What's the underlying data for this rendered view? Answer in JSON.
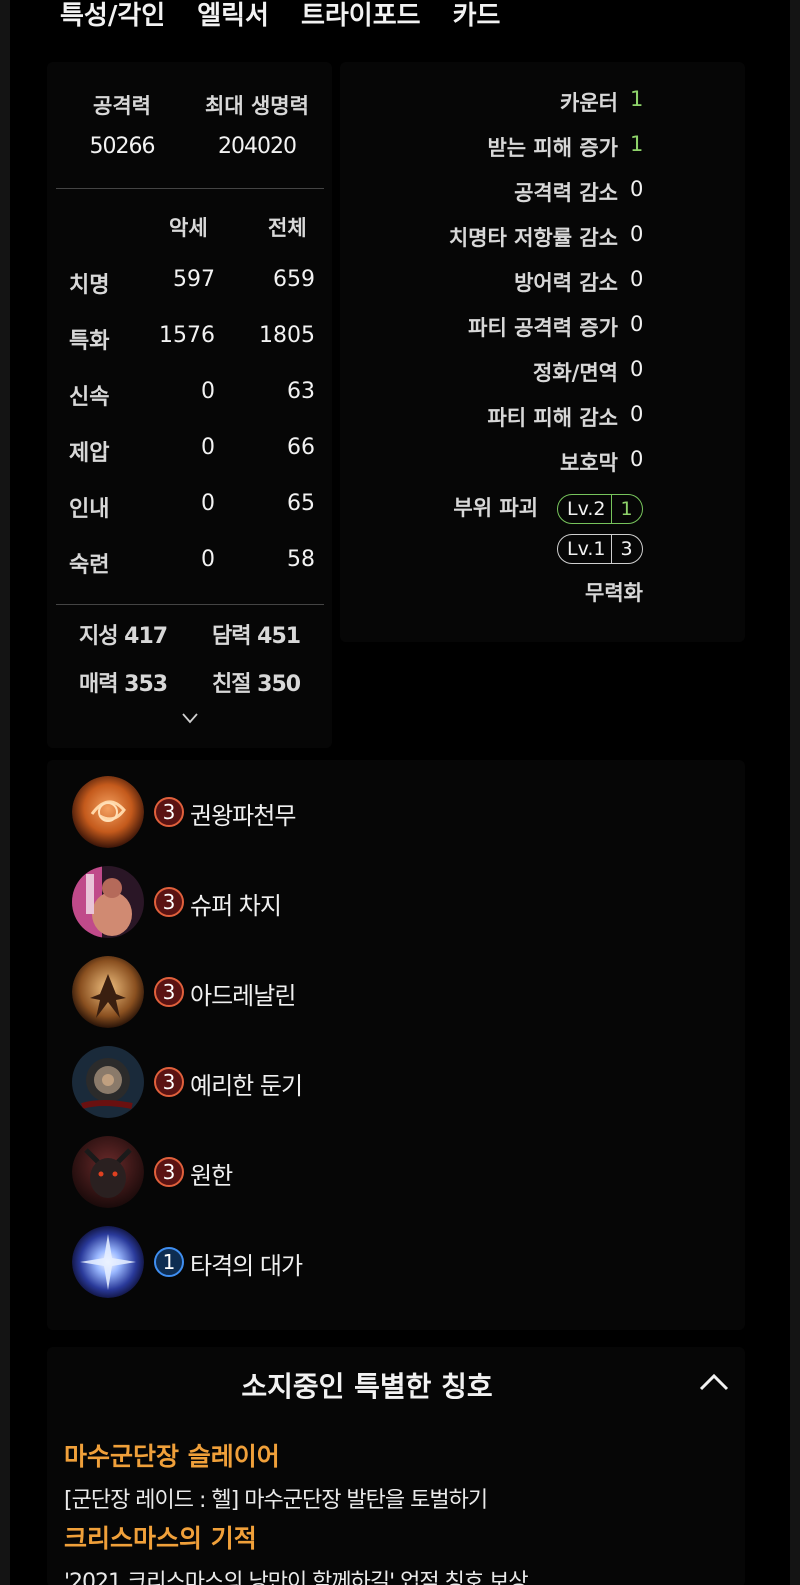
{
  "tabs": [
    "특성/각인",
    "엘릭서",
    "트라이포드",
    "카드"
  ],
  "headline": {
    "attack_label": "공격력",
    "attack_value": "50266",
    "hp_label": "최대 생명력",
    "hp_value": "204020"
  },
  "stats": {
    "col_accessory": "악세",
    "col_total": "전체",
    "rows": [
      {
        "name": "치명",
        "accessory": "597",
        "total": "659"
      },
      {
        "name": "특화",
        "accessory": "1576",
        "total": "1805"
      },
      {
        "name": "신속",
        "accessory": "0",
        "total": "63"
      },
      {
        "name": "제압",
        "accessory": "0",
        "total": "66"
      },
      {
        "name": "인내",
        "accessory": "0",
        "total": "65"
      },
      {
        "name": "숙련",
        "accessory": "0",
        "total": "58"
      }
    ]
  },
  "attributes": [
    {
      "label": "지성",
      "value": "417"
    },
    {
      "label": "담력",
      "value": "451"
    },
    {
      "label": "매력",
      "value": "353"
    },
    {
      "label": "친절",
      "value": "350"
    }
  ],
  "effects": [
    {
      "name": "카운터",
      "value": "1",
      "highlight": true
    },
    {
      "name": "받는 피해 증가",
      "value": "1",
      "highlight": true
    },
    {
      "name": "공격력 감소",
      "value": "0",
      "highlight": false
    },
    {
      "name": "치명타 저항률 감소",
      "value": "0",
      "highlight": false
    },
    {
      "name": "방어력 감소",
      "value": "0",
      "highlight": false
    },
    {
      "name": "파티 공격력 증가",
      "value": "0",
      "highlight": false
    },
    {
      "name": "정화/면역",
      "value": "0",
      "highlight": false
    },
    {
      "name": "파티 피해 감소",
      "value": "0",
      "highlight": false
    },
    {
      "name": "보호막",
      "value": "0",
      "highlight": false
    }
  ],
  "part_break": {
    "label": "부위 파괴",
    "levels": [
      {
        "level": "Lv.2",
        "count": "1",
        "color": "green"
      },
      {
        "level": "Lv.1",
        "count": "3",
        "color": "white"
      }
    ]
  },
  "neutralize_label": "무력화",
  "engravings": [
    {
      "level": "3",
      "name": "권왕파천무",
      "badge": "red",
      "icon": "fist-swirl-icon"
    },
    {
      "level": "3",
      "name": "슈퍼 차지",
      "badge": "red",
      "icon": "fighter-portrait-icon"
    },
    {
      "level": "3",
      "name": "아드레날린",
      "badge": "red",
      "icon": "adrenaline-figure-icon"
    },
    {
      "level": "3",
      "name": "예리한 둔기",
      "badge": "red",
      "icon": "spiked-mace-icon"
    },
    {
      "level": "3",
      "name": "원한",
      "badge": "red",
      "icon": "demon-head-icon"
    },
    {
      "level": "1",
      "name": "타격의 대가",
      "badge": "blue",
      "icon": "blue-impact-icon"
    }
  ],
  "titles_section": {
    "header": "소지중인 특별한 칭호",
    "items": [
      {
        "name": "마수군단장 슬레이어",
        "desc": "[군단장 레이드 : 헬] 마수군단장 발탄을 토벌하기"
      },
      {
        "name": "크리스마스의 기적",
        "desc": "'2021 크리스마스의 낭만이 함께하길' 업적 칭호 보상"
      }
    ]
  },
  "colors": {
    "accent_green": "#8ed26a",
    "title_orange": "#f0a03a",
    "badge_red": "#e0603c",
    "badge_blue": "#3f8ef0"
  }
}
